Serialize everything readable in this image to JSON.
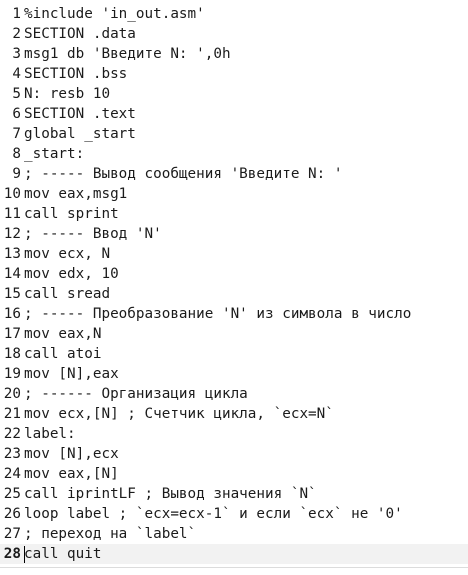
{
  "editor": {
    "current_line": 28,
    "lines": [
      {
        "num": "1",
        "text": "%include 'in_out.asm'"
      },
      {
        "num": "2",
        "text": "SECTION .data"
      },
      {
        "num": "3",
        "text": "msg1 db 'Введите N: ',0h"
      },
      {
        "num": "4",
        "text": "SECTION .bss"
      },
      {
        "num": "5",
        "text": "N: resb 10"
      },
      {
        "num": "6",
        "text": "SECTION .text"
      },
      {
        "num": "7",
        "text": "global _start"
      },
      {
        "num": "8",
        "text": "_start:"
      },
      {
        "num": "9",
        "text": "; ----- Вывод сообщения 'Введите N: '"
      },
      {
        "num": "10",
        "text": "mov eax,msg1"
      },
      {
        "num": "11",
        "text": "call sprint"
      },
      {
        "num": "12",
        "text": "; ----- Ввод 'N'"
      },
      {
        "num": "13",
        "text": "mov ecx, N"
      },
      {
        "num": "14",
        "text": "mov edx, 10"
      },
      {
        "num": "15",
        "text": "call sread"
      },
      {
        "num": "16",
        "text": "; ----- Преобразование 'N' из символа в число"
      },
      {
        "num": "17",
        "text": "mov eax,N"
      },
      {
        "num": "18",
        "text": "call atoi"
      },
      {
        "num": "19",
        "text": "mov [N],eax"
      },
      {
        "num": "20",
        "text": "; ------ Организация цикла"
      },
      {
        "num": "21",
        "text": "mov ecx,[N] ; Счетчик цикла, `ecx=N`"
      },
      {
        "num": "22",
        "text": "label:"
      },
      {
        "num": "23",
        "text": "mov [N],ecx"
      },
      {
        "num": "24",
        "text": "mov eax,[N]"
      },
      {
        "num": "25",
        "text": "call iprintLF ; Вывод значения `N`"
      },
      {
        "num": "26",
        "text": "loop label ; `ecx=ecx-1` и если `ecx` не '0'"
      },
      {
        "num": "27",
        "text": "; переход на `label`"
      },
      {
        "num": "28",
        "text": "call quit"
      }
    ]
  }
}
